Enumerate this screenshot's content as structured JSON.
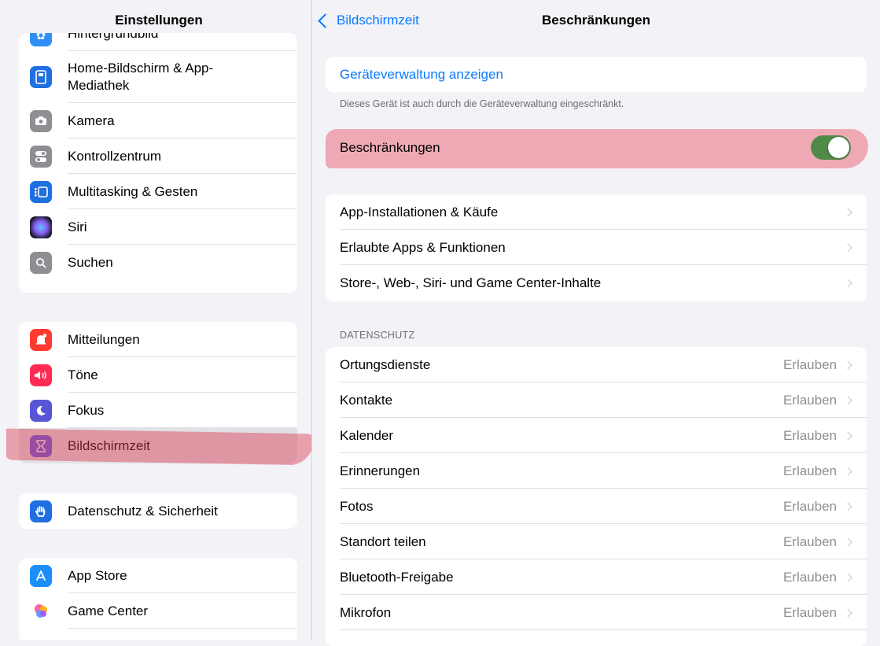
{
  "sidebar": {
    "title": "Einstellungen",
    "group1": [
      {
        "label": "Hintergrundbild",
        "icon": "flower-icon",
        "color": "#2f8ff5"
      },
      {
        "label": "Home-Bildschirm & App-\nMediathek",
        "icon": "home-screen-icon",
        "color": "#1f6fe0"
      },
      {
        "label": "Kamera",
        "icon": "camera-icon",
        "color": "#8e8e93"
      },
      {
        "label": "Kontrollzentrum",
        "icon": "toggles-icon",
        "color": "#8e8e93"
      },
      {
        "label": "Multitasking & Gesten",
        "icon": "multitasking-icon",
        "color": "#1f6fe0"
      },
      {
        "label": "Siri",
        "icon": "siri-icon",
        "color": "#222"
      },
      {
        "label": "Suchen",
        "icon": "search-icon",
        "color": "#8e8e93"
      }
    ],
    "group2": [
      {
        "label": "Mitteilungen",
        "icon": "notifications-icon",
        "color": "#ff3b30"
      },
      {
        "label": "Töne",
        "icon": "speaker-icon",
        "color": "#ff2d55"
      },
      {
        "label": "Fokus",
        "icon": "moon-icon",
        "color": "#5856d6"
      },
      {
        "label": "Bildschirmzeit",
        "icon": "hourglass-icon",
        "color": "#5e5ce6"
      }
    ],
    "group3": [
      {
        "label": "Datenschutz & Sicherheit",
        "icon": "hand-icon",
        "color": "#1f6fe0"
      }
    ],
    "group4": [
      {
        "label": "App Store",
        "icon": "app-store-icon",
        "color": "#1c8ef9"
      },
      {
        "label": "Game Center",
        "icon": "game-center-icon",
        "color": "#ffffff"
      }
    ]
  },
  "detail": {
    "back_label": "Bildschirmzeit",
    "title": "Beschränkungen",
    "device_mgmt_link": "Geräteverwaltung anzeigen",
    "device_mgmt_note": "Dieses Gerät ist auch durch die Geräteverwaltung eingeschränkt.",
    "restrictions_label": "Beschränkungen",
    "restrictions_on": true,
    "nav_rows": [
      {
        "label": "App-Installationen & Käufe"
      },
      {
        "label": "Erlaubte Apps & Funktionen"
      },
      {
        "label": "Store-, Web-, Siri- und Game Center-Inhalte"
      }
    ],
    "privacy_header": "DATENSCHUTZ",
    "privacy_rows": [
      {
        "label": "Ortungsdienste",
        "value": "Erlauben"
      },
      {
        "label": "Kontakte",
        "value": "Erlauben"
      },
      {
        "label": "Kalender",
        "value": "Erlauben"
      },
      {
        "label": "Erinnerungen",
        "value": "Erlauben"
      },
      {
        "label": "Fotos",
        "value": "Erlauben"
      },
      {
        "label": "Standort teilen",
        "value": "Erlauben"
      },
      {
        "label": "Bluetooth-Freigabe",
        "value": "Erlauben"
      },
      {
        "label": "Mikrofon",
        "value": "Erlauben"
      }
    ]
  },
  "colors": {
    "accent": "#0a7aff",
    "toggle_on": "#34c759",
    "highlight": "#e85064"
  }
}
